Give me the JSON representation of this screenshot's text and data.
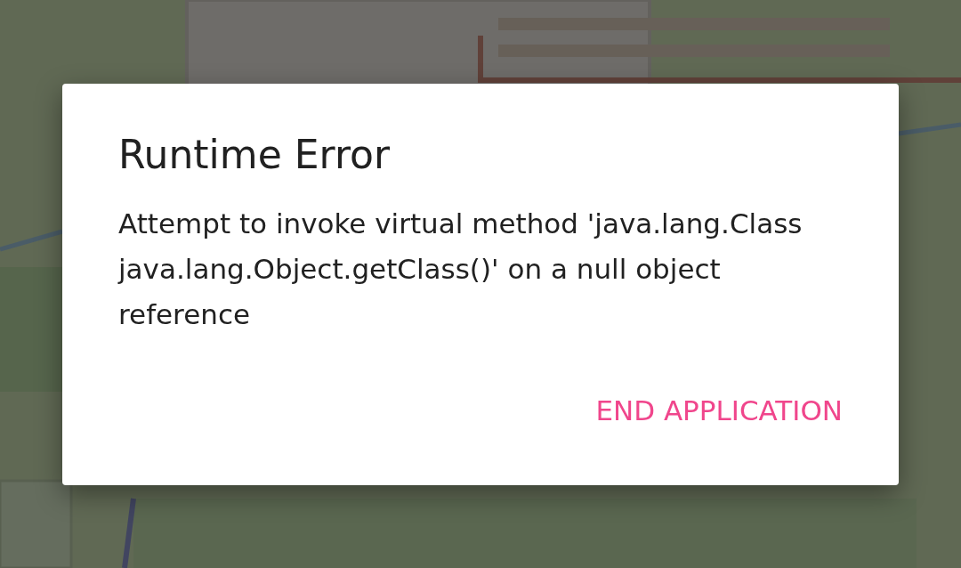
{
  "dialog": {
    "title": "Runtime Error",
    "message": "Attempt to invoke virtual method 'java.lang.Class java.lang.Object.getClass()' on a null object reference",
    "buttons": [
      {
        "label": "END APPLICATION"
      }
    ]
  }
}
